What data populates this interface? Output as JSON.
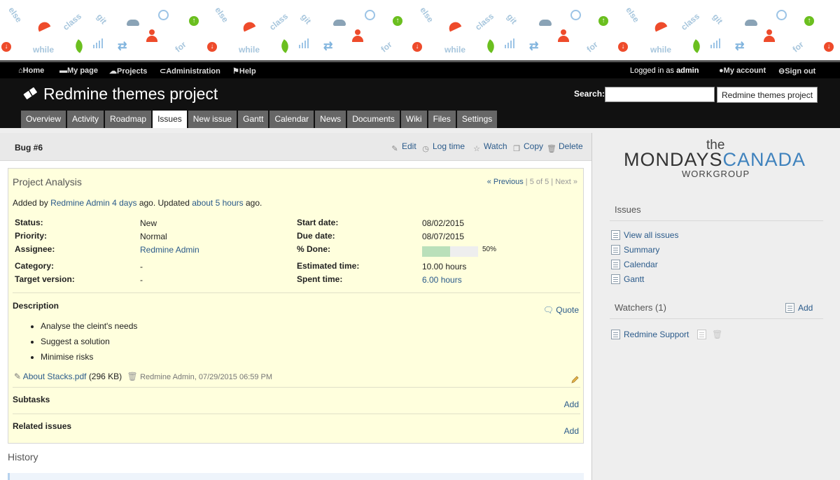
{
  "top_menu": {
    "home": "Home",
    "my_page": "My page",
    "projects": "Projects",
    "administration": "Administration",
    "help": "Help",
    "logged_in_prefix": "Logged in as",
    "logged_in_user": "admin",
    "my_account": "My account",
    "sign_out": "Sign out"
  },
  "banner": {
    "words": [
      "else",
      "class",
      "git",
      "while",
      "for"
    ]
  },
  "header": {
    "title": "Redmine themes project",
    "search_label": "Search:",
    "search_value": "",
    "jump_value": "Redmine themes project"
  },
  "tabs": [
    {
      "label": "Overview"
    },
    {
      "label": "Activity"
    },
    {
      "label": "Roadmap"
    },
    {
      "label": "Issues",
      "selected": true
    },
    {
      "label": "New issue"
    },
    {
      "label": "Gantt"
    },
    {
      "label": "Calendar"
    },
    {
      "label": "News"
    },
    {
      "label": "Documents"
    },
    {
      "label": "Wiki"
    },
    {
      "label": "Files"
    },
    {
      "label": "Settings"
    }
  ],
  "issue": {
    "id_label": "Bug #6",
    "actions": {
      "edit": "Edit",
      "log_time": "Log time",
      "watch": "Watch",
      "copy": "Copy",
      "delete": "Delete"
    },
    "subject": "Project Analysis",
    "pager": {
      "previous": "« Previous",
      "position": "5 of 5",
      "next": "Next »"
    },
    "author_line": {
      "added_by": "Added by",
      "author": "Redmine Admin",
      "created_ago": "4 days",
      "ago_updated": "ago. Updated",
      "updated_ago": "about 5 hours",
      "ago": "ago."
    },
    "attributes": {
      "status_label": "Status:",
      "status": "New",
      "priority_label": "Priority:",
      "priority": "Normal",
      "assignee_label": "Assignee:",
      "assignee": "Redmine Admin",
      "category_label": "Category:",
      "category": "-",
      "target_label": "Target version:",
      "target": "-",
      "start_label": "Start date:",
      "start": "08/02/2015",
      "due_label": "Due date:",
      "due": "08/07/2015",
      "done_label": "% Done:",
      "done_text": "50%",
      "done_fraction": 0.5,
      "estimated_label": "Estimated time:",
      "estimated": "10.00 hours",
      "spent_label": "Spent time:",
      "spent": "6.00 hours"
    },
    "description_title": "Description",
    "quote": "Quote",
    "description_items": [
      "Analyse the cleint's needs",
      "Suggest a solution",
      "Minimise risks"
    ],
    "attachment": {
      "name": "About Stacks.pdf",
      "size": "(296 KB)",
      "meta": "Redmine Admin, 07/29/2015 06:59 PM"
    },
    "subtasks_title": "Subtasks",
    "subtasks_add": "Add",
    "related_title": "Related issues",
    "related_add": "Add",
    "history_title": "History"
  },
  "sidebar": {
    "logo": {
      "the": "the",
      "mondays": "MONDAYS",
      "canada": "CANADA",
      "workgroup": "WORKGROUP"
    },
    "issues_title": "Issues",
    "links": [
      "View all issues",
      "Summary",
      "Calendar",
      "Gantt"
    ],
    "watchers_title": "Watchers (1)",
    "watchers_add": "Add",
    "watcher": "Redmine Support"
  },
  "colors": {
    "accent_link": "#2a5a8a",
    "issue_bg": "#ffffdd",
    "progress_done": "#bae0ba"
  }
}
